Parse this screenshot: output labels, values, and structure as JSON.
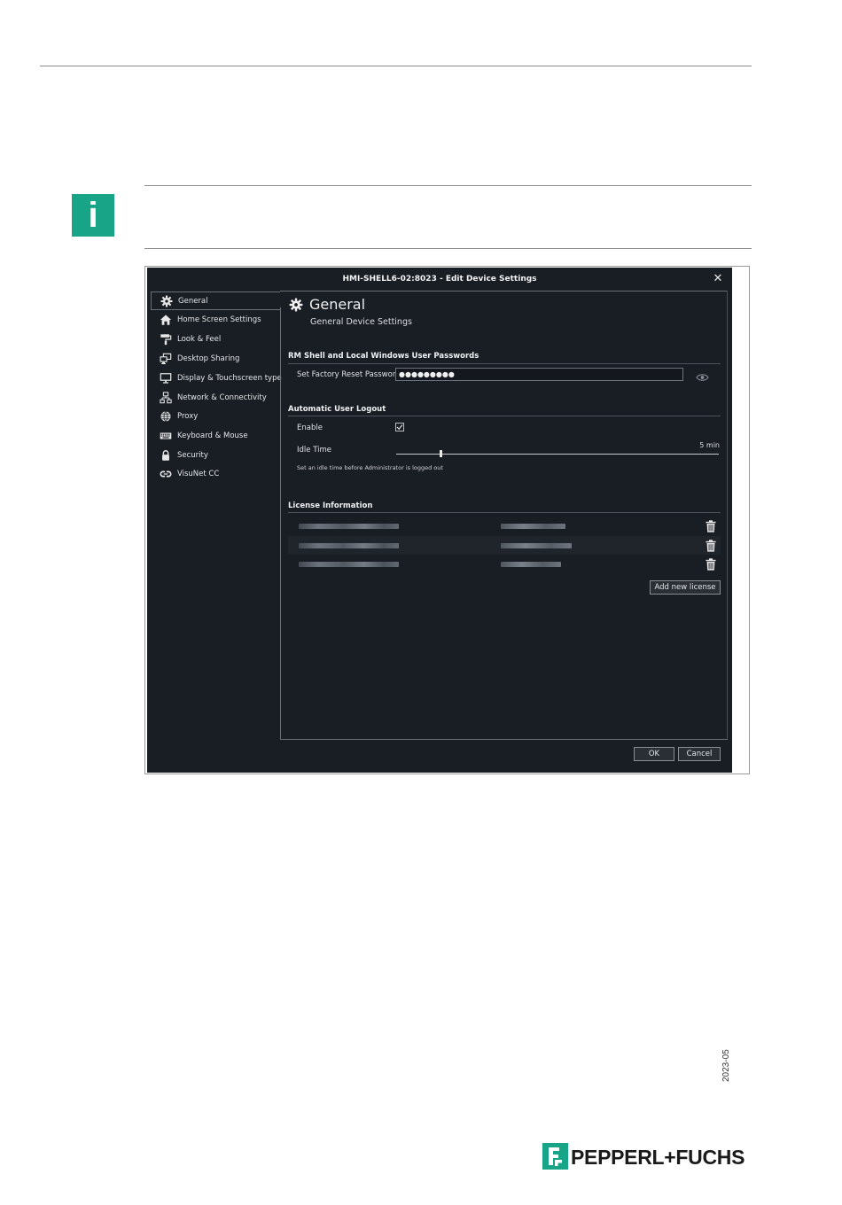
{
  "document": {
    "info_symbol": "i",
    "year_stamp": "2023-05",
    "brand_logo_text": "PEPPERL+FUCHS",
    "brand_color": "#17a487"
  },
  "window": {
    "title": "HMI-SHELL6-02:8023 - Edit Device Settings",
    "close_icon": "close-icon"
  },
  "sidebar": {
    "items": [
      {
        "label": "General",
        "icon": "gear-icon",
        "active": true
      },
      {
        "label": "Home Screen Settings",
        "icon": "home-icon"
      },
      {
        "label": "Look & Feel",
        "icon": "paint-roller-icon"
      },
      {
        "label": "Desktop Sharing",
        "icon": "desktop-sharing-icon"
      },
      {
        "label": "Display & Touchscreen type",
        "icon": "monitor-icon"
      },
      {
        "label": "Network & Connectivity",
        "icon": "network-icon"
      },
      {
        "label": "Proxy",
        "icon": "globe-icon"
      },
      {
        "label": "Keyboard & Mouse",
        "icon": "keyboard-icon"
      },
      {
        "label": "Security",
        "icon": "lock-icon"
      },
      {
        "label": "VisuNet CC",
        "icon": "link-icon"
      }
    ]
  },
  "main": {
    "heading": "General",
    "subheading": "General Device Settings",
    "passwords": {
      "section_title": "RM Shell and Local Windows User Passwords",
      "label": "Set Factory Reset Password",
      "value": "●●●●●●●●●"
    },
    "logout": {
      "section_title": "Automatic User Logout",
      "enable_label": "Enable",
      "enable_checked": true,
      "idle_label": "Idle Time",
      "idle_value": "5 min",
      "idle_level": 0.14,
      "hint": "Set an idle time before Administrator is logged out"
    },
    "licenses": {
      "section_title": "License Information",
      "rows_obscured": 3,
      "add_button": "Add new license"
    }
  },
  "footer": {
    "ok": "OK",
    "cancel": "Cancel"
  }
}
